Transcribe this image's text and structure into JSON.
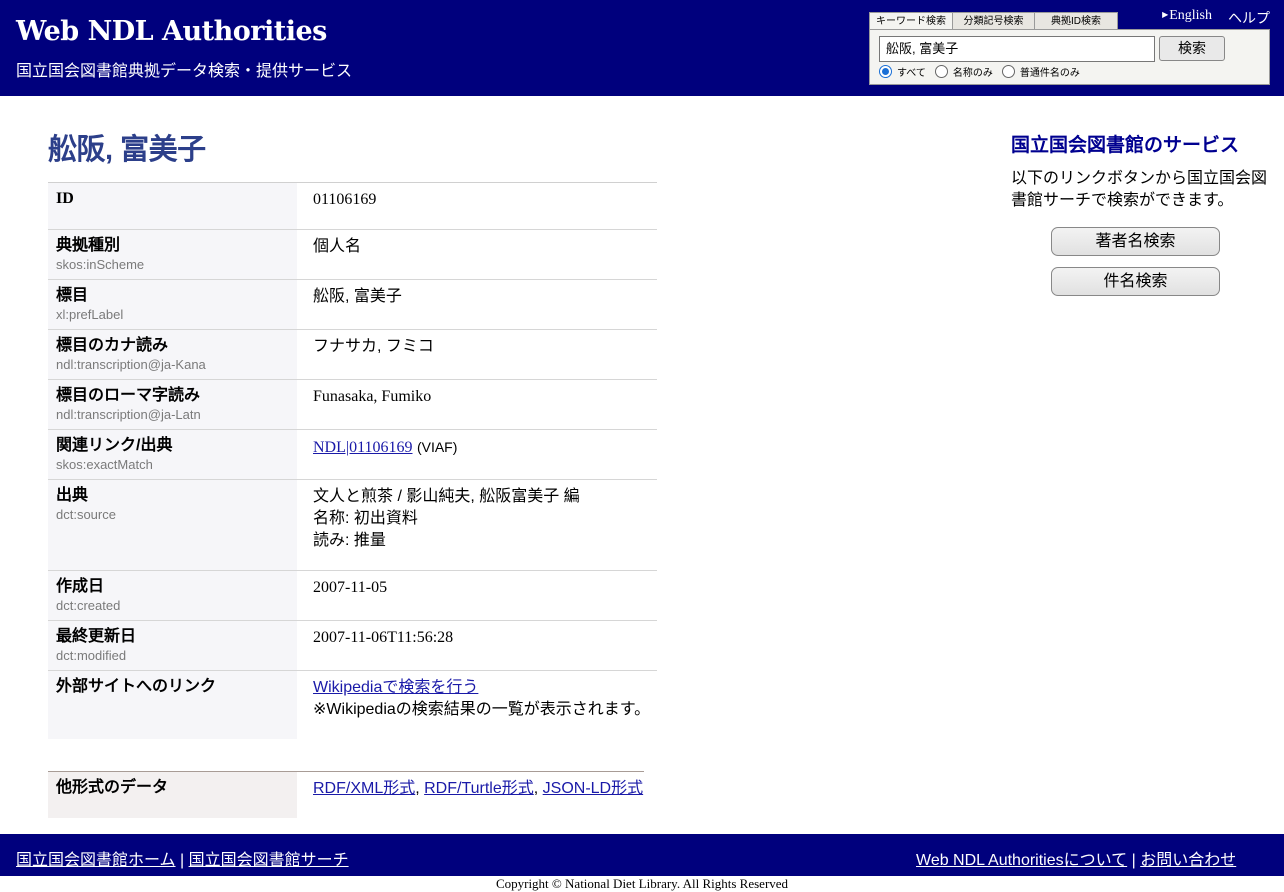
{
  "header": {
    "title": "Web NDL Authorities",
    "subtitle": "国立国会図書館典拠データ検索・提供サービス",
    "english_link": "English",
    "help_link": "ヘルプ"
  },
  "search": {
    "tabs": [
      "キーワード検索",
      "分類記号検索",
      "典拠ID検索"
    ],
    "active_tab": "キーワード検索",
    "query": "舩阪, 富美子",
    "button_label": "検索",
    "options": [
      "すべて",
      "名称のみ",
      "普通件名のみ"
    ],
    "selected_option": "すべて"
  },
  "record": {
    "title": "舩阪, 富美子",
    "fields": [
      {
        "label": "ID",
        "property": "",
        "value": "01106169"
      },
      {
        "label": "典拠種別",
        "property": "skos:inScheme",
        "value": "個人名"
      },
      {
        "label": "標目",
        "property": "xl:prefLabel",
        "value": "舩阪, 富美子"
      },
      {
        "label": "標目のカナ読み",
        "property": "ndl:transcription@ja-Kana",
        "value": "フナサカ, フミコ"
      },
      {
        "label": "標目のローマ字読み",
        "property": "ndl:transcription@ja-Latn",
        "value": "Funasaka, Fumiko"
      },
      {
        "label": "関連リンク/出典",
        "property": "skos:exactMatch",
        "link": "NDL|01106169",
        "note": "(VIAF)"
      },
      {
        "label": "出典",
        "property": "dct:source",
        "lines": [
          "文人と煎茶 / 影山純夫, 舩阪富美子 編",
          "名称: 初出資料",
          "読み: 推量"
        ]
      },
      {
        "label": "作成日",
        "property": "dct:created",
        "value": "2007-11-05"
      },
      {
        "label": "最終更新日",
        "property": "dct:modified",
        "value": "2007-11-06T11:56:28"
      },
      {
        "label": "外部サイトへのリンク",
        "property": "",
        "link": "Wikipediaで検索を行う",
        "note": "※Wikipediaの検索結果の一覧が表示されます。"
      }
    ]
  },
  "formats": {
    "label": "他形式のデータ",
    "links": [
      "RDF/XML形式",
      "RDF/Turtle形式",
      "JSON-LD形式"
    ],
    "separator": ", "
  },
  "sidebar": {
    "title": "国立国会図書館のサービス",
    "description": "以下のリンクボタンから国立国会図書館サーチで検索ができます。",
    "buttons": [
      "著者名検索",
      "件名検索"
    ]
  },
  "footer": {
    "left_links": [
      "国立国会図書館ホーム",
      "国立国会図書館サーチ"
    ],
    "right_links": [
      "Web NDL Authoritiesについて",
      "お問い合わせ"
    ],
    "separator": " | ",
    "copyright": "Copyright © National Diet Library. All Rights Reserved"
  },
  "colors": {
    "header_bg": "#00007d",
    "title_color": "#2c3f8a",
    "link_color": "#1a1aa8"
  }
}
